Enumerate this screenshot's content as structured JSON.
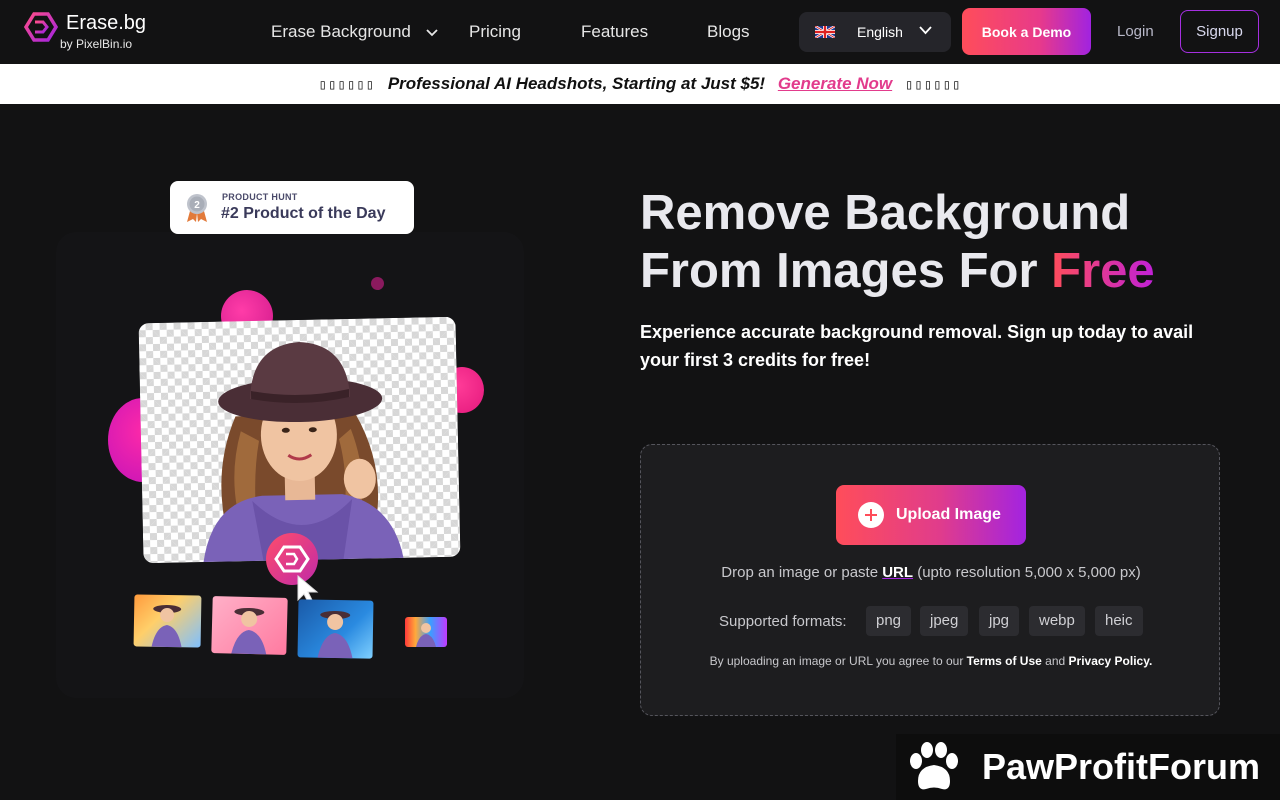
{
  "brand": {
    "name": "Erase.bg",
    "sub": "by PixelBin.io"
  },
  "nav": {
    "links": [
      {
        "label": "Erase Background",
        "has_dropdown": true
      },
      {
        "label": "Pricing"
      },
      {
        "label": "Features"
      },
      {
        "label": "Blogs"
      }
    ],
    "language": {
      "label": "English",
      "flag": "uk-flag-icon"
    },
    "demo_button": "Book a Demo",
    "login": "Login",
    "signup": "Signup"
  },
  "banner": {
    "emoji_left": "▯▯▯▯▯▯",
    "text": "Professional AI Headshots, Starting at Just $5!",
    "cta": "Generate Now",
    "emoji_right": "▯▯▯▯▯▯"
  },
  "badge": {
    "small": "PRODUCT HUNT",
    "title": "#2 Product of the Day",
    "rank": "2"
  },
  "hero": {
    "headline_line1": "Remove Background",
    "headline_line2_prefix": "From Images For ",
    "headline_highlight": "Free",
    "subhead": "Experience accurate background removal. Sign up today to avail your first 3 credits for free!"
  },
  "upload": {
    "button": "Upload Image",
    "drop_prefix": "Drop an image or paste ",
    "drop_url": "URL",
    "drop_suffix": " (upto resolution 5,000 x 5,000 px)",
    "formats_label": "Supported formats:",
    "formats": [
      "png",
      "jpeg",
      "jpg",
      "webp",
      "heic"
    ],
    "terms_prefix": "By uploading an image or URL you agree to our ",
    "terms_link": "Terms of Use",
    "terms_and": " and ",
    "privacy_link": "Privacy Policy."
  },
  "watermark": {
    "text": "PawProfitForum"
  },
  "colors": {
    "bg": "#121213",
    "accent_start": "#ff4d5a",
    "accent_end": "#a323e0",
    "link_pink": "#e23b8c"
  }
}
